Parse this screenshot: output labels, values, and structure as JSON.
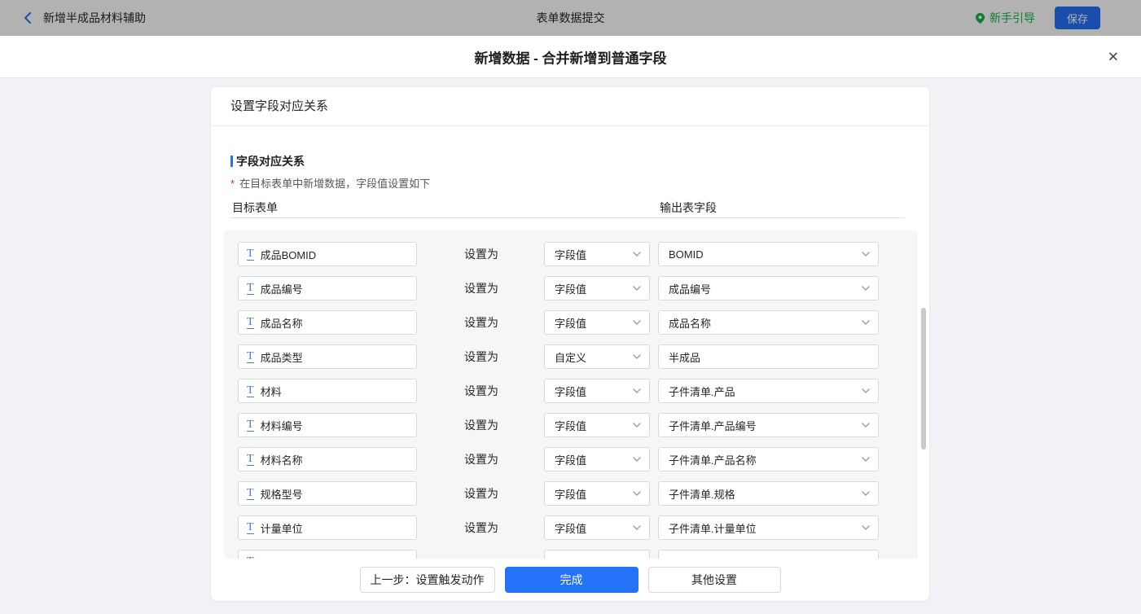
{
  "topbar": {
    "back_label": "新增半成品材料辅助",
    "center_title": "表单数据提交",
    "guide_label": "新手引导",
    "save_label": "保存"
  },
  "modal": {
    "title": "新增数据 - 合并新增到普通字段",
    "close_icon": "✕",
    "card": {
      "header": "设置字段对应关系",
      "section_title": "字段对应关系",
      "required_mark": "*",
      "hint": "在目标表单中新增数据，字段值设置如下",
      "columns": {
        "left": "目标表单",
        "right": "输出表字段"
      },
      "set_as_label": "设置为",
      "rows": [
        {
          "field": "成品BOMID",
          "mode": "字段值",
          "value": "BOMID",
          "value_type": "select"
        },
        {
          "field": "成品编号",
          "mode": "字段值",
          "value": "成品编号",
          "value_type": "select"
        },
        {
          "field": "成品名称",
          "mode": "字段值",
          "value": "成品名称",
          "value_type": "select"
        },
        {
          "field": "成品类型",
          "mode": "自定义",
          "value": "半成品",
          "value_type": "input"
        },
        {
          "field": "材料",
          "mode": "字段值",
          "value": "子件清单.产品",
          "value_type": "select"
        },
        {
          "field": "材料编号",
          "mode": "字段值",
          "value": "子件清单.产品编号",
          "value_type": "select"
        },
        {
          "field": "材料名称",
          "mode": "字段值",
          "value": "子件清单.产品名称",
          "value_type": "select"
        },
        {
          "field": "规格型号",
          "mode": "字段值",
          "value": "子件清单.规格",
          "value_type": "select"
        },
        {
          "field": "计量单位",
          "mode": "字段值",
          "value": "子件清单.计量单位",
          "value_type": "select"
        },
        {
          "field": "",
          "mode": "",
          "value": "",
          "value_type": "select"
        }
      ],
      "footer": {
        "prev": "上一步：设置触发动作",
        "done": "完成",
        "other": "其他设置"
      }
    }
  },
  "icons": {
    "text_field": "T",
    "back": "chevron-left",
    "guide": "location-pin",
    "select_arrow": "chevron-down",
    "close": "x"
  },
  "colors": {
    "accent_blue": "#2472F5",
    "guide_green": "#16B34A",
    "required_red": "#F5222D",
    "body_bg": "#F0F2F5",
    "overlay": "rgba(0,0,0,0.30)"
  }
}
